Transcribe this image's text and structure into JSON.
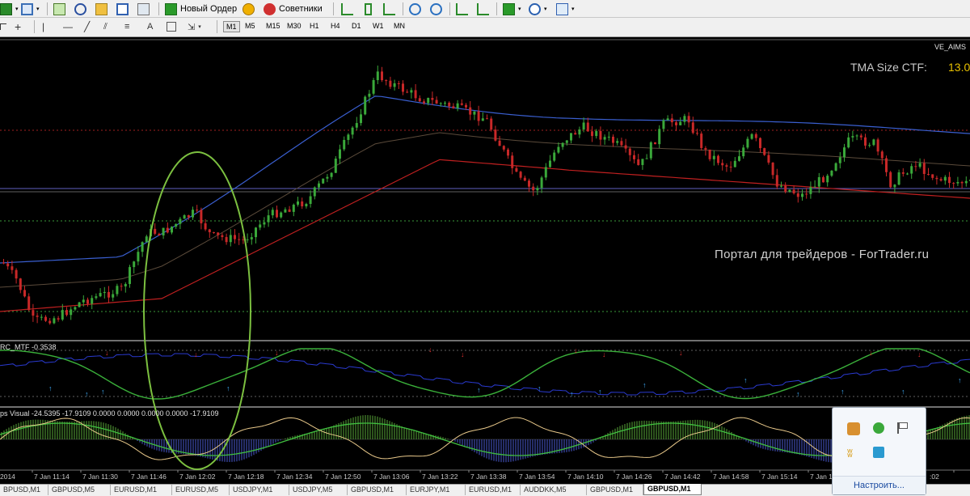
{
  "toolbar": {
    "new_order_label": "Новый Ордер",
    "advisors_label": "Советники",
    "text_tool_label": "A",
    "timeframes": [
      "M1",
      "M5",
      "M15",
      "M30",
      "H1",
      "H4",
      "D1",
      "W1",
      "MN"
    ],
    "active_timeframe": "M1"
  },
  "chart": {
    "indicator_name": "VE_AIMS",
    "tma_label": "TMA Size CTF:",
    "tma_value": "13.0",
    "watermark": "Портал для трейдеров - ForTrader.ru",
    "sub1_label": "RC_MTF -0.3538",
    "sub2_label": "ps Visual -24.5395 -17.9109 0.0000 0.0000 0.0000 0.0000 -17.9109",
    "time_labels": [
      "2014",
      "7 Jan 11:14",
      "7 Jan 11:30",
      "7 Jan 11:46",
      "7 Jan 12:02",
      "7 Jan 12:18",
      "7 Jan 12:34",
      "7 Jan 12:50",
      "7 Jan 13:06",
      "7 Jan 13:22",
      "7 Jan 13:38",
      "7 Jan 13:54",
      "7 Jan 14:10",
      "7 Jan 14:26",
      "7 Jan 14:42",
      "7 Jan 14:58",
      "7 Jan 15:14",
      "7 Jan 1",
      ":02"
    ],
    "colors": {
      "bull": "#3aa83a",
      "bear": "#c82828",
      "tma_upper": "#3a5fd0",
      "tma_lower": "#c02020",
      "highlight_ellipse": "#7cc040",
      "label_yellow": "#e8c000"
    }
  },
  "tabs": [
    "BPUSD,M1",
    "GBPUSD,M5",
    "EURUSD,M1",
    "EURUSD,M5",
    "USDJPY,M1",
    "USDJPY,M5",
    "GBPUSD,M1",
    "EURJPY,M1",
    "EURUSD,M1",
    "AUDDKK,M5",
    "GBPUSD,M1",
    "GBPUSD,M1"
  ],
  "active_tab_index": 11,
  "tray": {
    "customize_link": "Настроить..."
  }
}
